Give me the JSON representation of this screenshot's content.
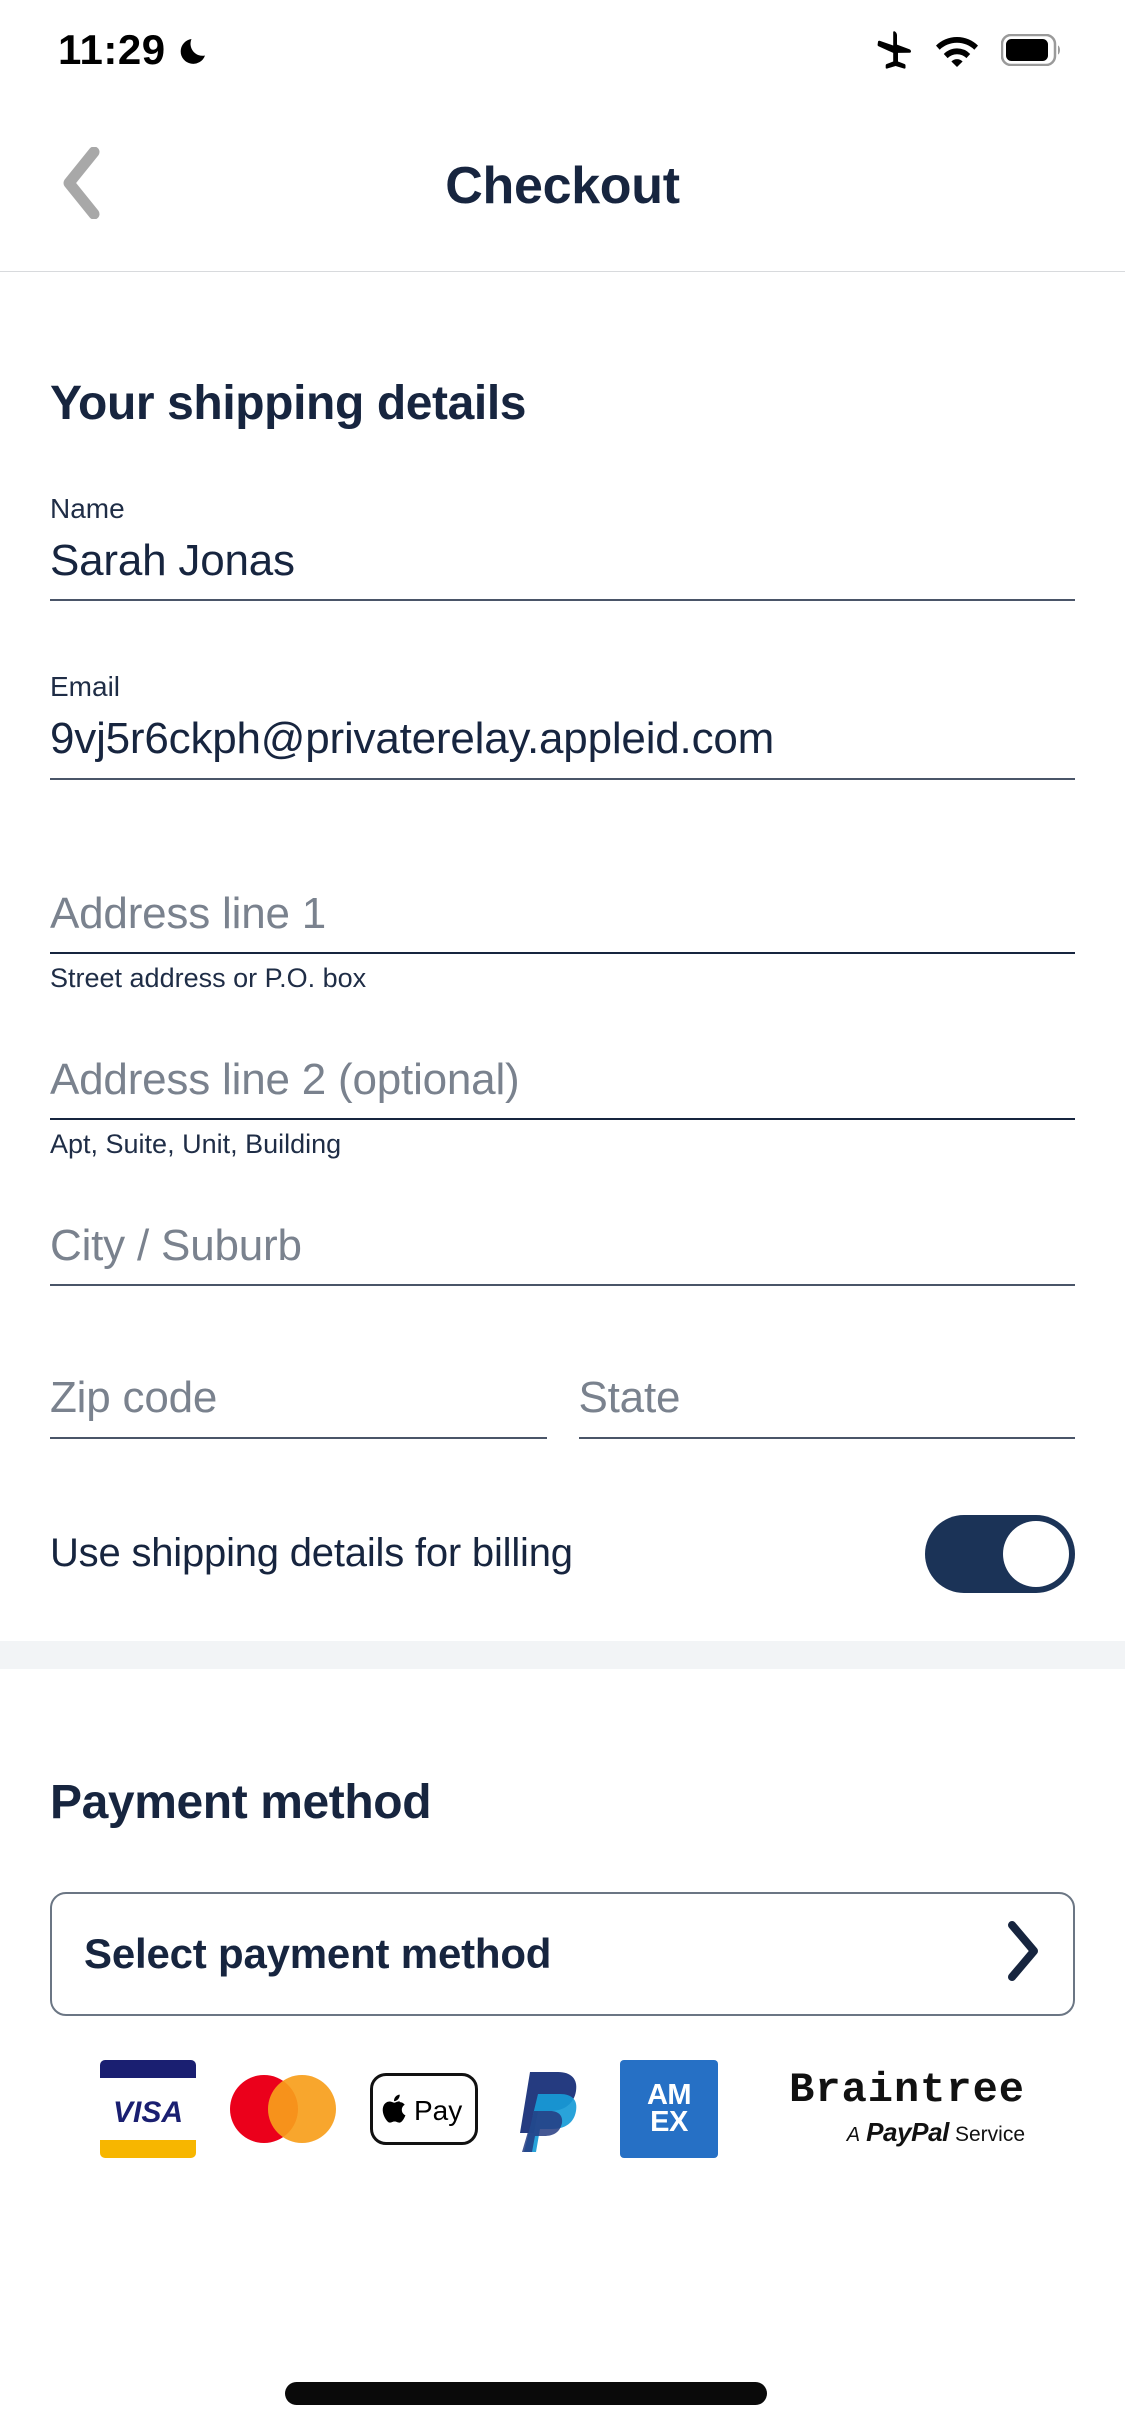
{
  "status_bar": {
    "time": "11:29",
    "icons": [
      "moon-icon",
      "airplane-mode-icon",
      "wifi-icon",
      "battery-icon"
    ]
  },
  "nav": {
    "back_icon": "chevron-left-icon",
    "title": "Checkout"
  },
  "shipping": {
    "heading": "Your shipping details",
    "fields": [
      {
        "label": "Name",
        "value": "Sarah Jonas",
        "placeholder": "",
        "help": ""
      },
      {
        "label": "Email",
        "value": "9vj5r6ckph@privaterelay.appleid.com",
        "placeholder": "",
        "help": ""
      },
      {
        "label": "",
        "value": "",
        "placeholder": "Address line 1",
        "help": "Street address or P.O. box"
      },
      {
        "label": "",
        "value": "",
        "placeholder": "Address line 2 (optional)",
        "help": "Apt, Suite, Unit, Building"
      },
      {
        "label": "",
        "value": "",
        "placeholder": "City / Suburb",
        "help": ""
      },
      {
        "label": "",
        "value": "",
        "placeholder": "Zip code",
        "help": ""
      },
      {
        "label": "",
        "value": "",
        "placeholder": "State",
        "help": ""
      }
    ],
    "billing_toggle": {
      "label": "Use shipping details for billing",
      "state": "on"
    }
  },
  "payment": {
    "heading": "Payment method",
    "select_label": "Select payment method",
    "select_icon": "chevron-right-icon",
    "accepted_logos": [
      "visa-logo",
      "mastercard-logo",
      "apple-pay-logo",
      "paypal-logo",
      "amex-logo"
    ],
    "amex_line1": "AM",
    "amex_line2": "EX",
    "visa_text": "VISA",
    "apple_pay_text": "Pay",
    "branding": {
      "name": "Braintree",
      "tagline_a": "A",
      "tagline_brand": "PayPal",
      "tagline_service": "Service"
    }
  },
  "colors": {
    "navy": "#17253f",
    "toggle_on": "#1b3357",
    "placeholder_gray": "#7a828e",
    "border_gray": "#6b7684",
    "band_gray": "#f2f4f6"
  }
}
